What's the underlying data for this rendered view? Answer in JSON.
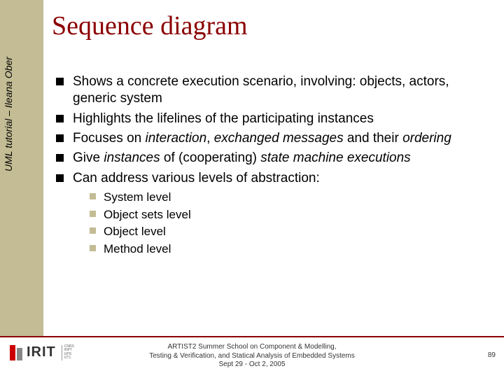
{
  "sidebar": {
    "label": "UML tutorial – Ileana Ober"
  },
  "title": "Sequence diagram",
  "bullets": {
    "b1_pre": "Shows a concrete execution scenario, involving: objects, actors, generic system",
    "b2": "Highlights the lifelines of the participating instances",
    "b3_pre": "Focuses on ",
    "b3_em1": "interaction",
    "b3_mid": ", ",
    "b3_em2": "exchanged messages",
    "b3_post": " and their ",
    "b3_em3": "ordering",
    "b4_pre": "Give ",
    "b4_em1": "instances",
    "b4_mid": " of (cooperating) ",
    "b4_em2": "state machine executions",
    "b5": "Can address various levels of abstraction:"
  },
  "sub": {
    "s1": "System level",
    "s2": "Object sets level",
    "s3": "Object level",
    "s4": "Method level"
  },
  "footer": {
    "line1": "ARTIST2 Summer School on Component & Modelling,",
    "line2": "Testing & Verification, and Statical Analysis of Embedded Systems",
    "line3": "Sept 29 - Oct 2, 2005"
  },
  "logo": {
    "text": "IRIT",
    "sub1": "CNRS",
    "sub2": "INPT",
    "sub3": "UPS",
    "sub4": "UT1"
  },
  "page": "89"
}
